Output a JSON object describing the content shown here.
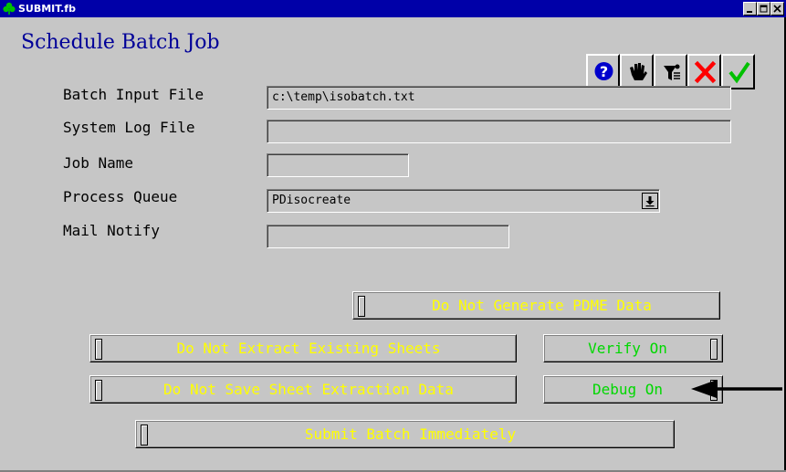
{
  "window": {
    "title": "SUBMIT.fb",
    "controls": [
      "minimize",
      "restore",
      "close"
    ]
  },
  "header": {
    "title": "Schedule Batch Job",
    "toolbar_icons": [
      "help-icon",
      "hand-icon",
      "filter-icon",
      "cancel-icon",
      "ok-icon"
    ]
  },
  "form": {
    "batch_input_file": {
      "label": "Batch Input File",
      "value": "c:\\temp\\isobatch.txt"
    },
    "system_log_file": {
      "label": "System Log File",
      "value": ""
    },
    "job_name": {
      "label": "Job Name",
      "value": ""
    },
    "process_queue": {
      "label": "Process Queue",
      "value": "PDisocreate"
    },
    "mail_notify": {
      "label": "Mail Notify",
      "value": ""
    }
  },
  "toggles": {
    "pdme": {
      "label": "Do Not Generate PDME Data",
      "state": "off"
    },
    "extract": {
      "label": "Do Not Extract Existing Sheets",
      "state": "off"
    },
    "verify": {
      "label": "Verify On",
      "state": "on"
    },
    "save_extraction": {
      "label": "Do Not Save Sheet Extraction Data",
      "state": "off"
    },
    "debug": {
      "label": "Debug On",
      "state": "on"
    },
    "submit": {
      "label": "Submit Batch Immediately",
      "state": "off"
    }
  },
  "colors": {
    "title_bar": "#0000a8",
    "title_text": "#000098",
    "toggle_off_text": "#ffff00",
    "toggle_on_text": "#00d800",
    "panel": "#c6c6c6"
  }
}
